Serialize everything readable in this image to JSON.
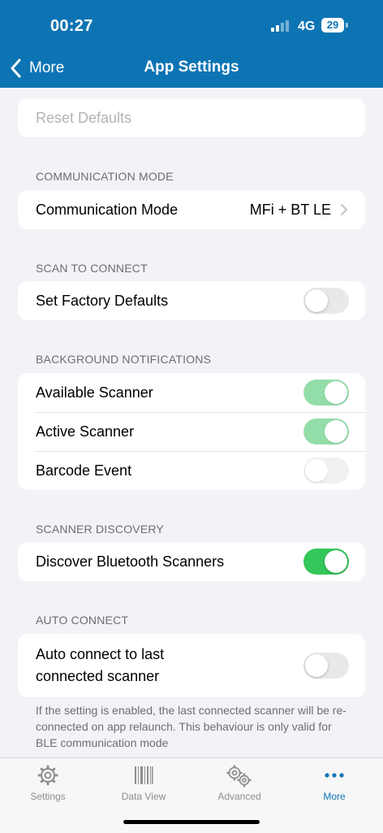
{
  "status_bar": {
    "time": "00:27",
    "network": "4G",
    "battery": "29"
  },
  "nav": {
    "back_label": "More",
    "title": "App Settings"
  },
  "reset": {
    "label": "Reset Defaults"
  },
  "communication": {
    "header": "COMMUNICATION MODE",
    "label": "Communication Mode",
    "value": "MFi + BT LE"
  },
  "scan_to_connect": {
    "header": "SCAN TO CONNECT",
    "label": "Set Factory Defaults",
    "enabled": false
  },
  "background_notifications": {
    "header": "BACKGROUND NOTIFICATIONS",
    "items": [
      {
        "label": "Available Scanner",
        "enabled": true
      },
      {
        "label": "Active Scanner",
        "enabled": true
      },
      {
        "label": "Barcode Event",
        "enabled": false
      }
    ]
  },
  "scanner_discovery": {
    "header": "SCANNER DISCOVERY",
    "label": "Discover Bluetooth Scanners",
    "enabled": true
  },
  "auto_connect": {
    "header": "AUTO CONNECT",
    "label_line1": "Auto connect to last",
    "label_line2": "connected scanner",
    "enabled": false,
    "footnote": "If the setting is enabled, the last connected scanner will be re-connected on app relaunch. This behaviour is only valid for BLE communication mode"
  },
  "tabs": [
    {
      "label": "Settings",
      "icon": "gear-icon"
    },
    {
      "label": "Data View",
      "icon": "barcode-icon"
    },
    {
      "label": "Advanced",
      "icon": "gears-icon"
    },
    {
      "label": "More",
      "icon": "ellipsis-icon",
      "active": true
    }
  ],
  "colors": {
    "header": "#0d74b4",
    "toggle_on": "#34c759",
    "toggle_on_dimmed": "#93dda9",
    "background": "#f2f2f7"
  }
}
